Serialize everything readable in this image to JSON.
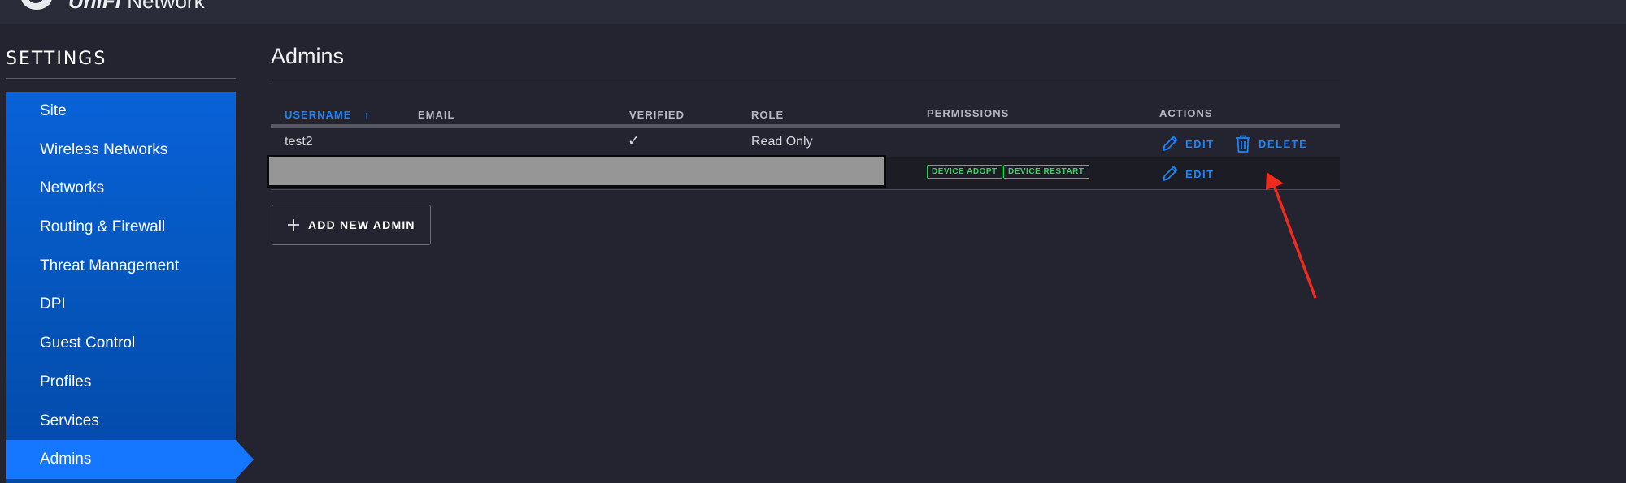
{
  "header": {
    "brand_bold": "UniFi",
    "brand_rest": " Network"
  },
  "sidebar": {
    "title": "SETTINGS",
    "items": [
      {
        "label": "Site"
      },
      {
        "label": "Wireless Networks"
      },
      {
        "label": "Networks"
      },
      {
        "label": "Routing & Firewall"
      },
      {
        "label": "Threat Management"
      },
      {
        "label": "DPI"
      },
      {
        "label": "Guest Control"
      },
      {
        "label": "Profiles"
      },
      {
        "label": "Services"
      },
      {
        "label": "Admins",
        "active": true
      }
    ]
  },
  "main": {
    "title": "Admins",
    "table": {
      "columns": [
        "USERNAME",
        "EMAIL",
        "VERIFIED",
        "ROLE",
        "PERMISSIONS",
        "ACTIONS"
      ],
      "sort_indicator": "↑",
      "rows": [
        {
          "username": "test2",
          "email": "",
          "verified": "✓",
          "role": "Read Only",
          "permissions": [],
          "actions": [
            "EDIT",
            "DELETE"
          ]
        },
        {
          "username": "",
          "email": "",
          "verified": "",
          "role": "",
          "permissions": [
            "DEVICE ADOPT",
            "DEVICE RESTART"
          ],
          "actions": [
            "EDIT"
          ]
        }
      ]
    },
    "add_button": {
      "icon": "plus-icon",
      "label": "ADD NEW ADMIN"
    }
  },
  "colors": {
    "background": "#23242f",
    "sidebar": "#0560d8",
    "sidebar_active": "#1577ff",
    "link": "#1a84ff",
    "badge": "#3fd066",
    "annotation_arrow": "#ee2b1e"
  }
}
